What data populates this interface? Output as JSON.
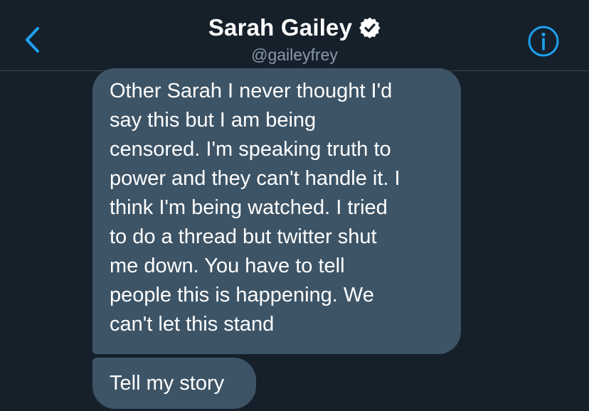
{
  "header": {
    "name": "Sarah Gailey",
    "handle": "@gaileyfrey",
    "back_icon": "chevron-left-icon",
    "info_icon": "info-circle-icon",
    "verified_icon": "verified-badge-icon",
    "accent_color": "#1da1f2"
  },
  "messages": [
    {
      "lines": [
        "Other Sarah I never thought I'd",
        "say this but I am being",
        "censored. I'm speaking truth to",
        "power and they can't handle it. I",
        "think I'm being watched. I tried",
        "to do a thread but twitter shut",
        "me down. You have to tell",
        "people this is happening. We",
        "can't let this stand"
      ]
    },
    {
      "lines": [
        "Tell my story"
      ]
    }
  ],
  "colors": {
    "background": "#15202b",
    "bubble": "#3d5466",
    "divider": "#38444d",
    "secondary_text": "#8899a6"
  }
}
